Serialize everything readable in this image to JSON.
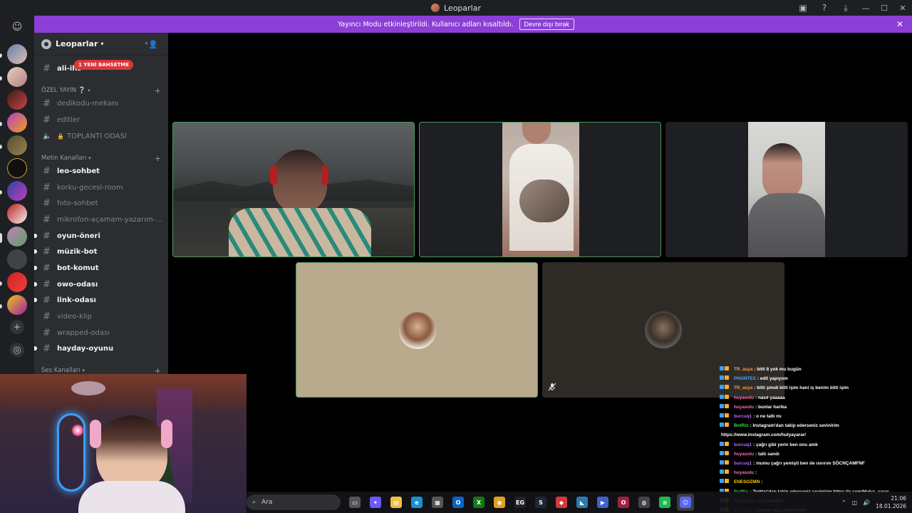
{
  "window": {
    "title": "Leoparlar"
  },
  "banner": {
    "text": "Yayıncı Modu etkinleştirildi. Kullanıcı adları kısaltıldı.",
    "button": "Devre dışı bırak"
  },
  "server": {
    "name": "Leoparlar"
  },
  "channels": {
    "top": {
      "name": "ali-ihs",
      "badge": "1 YENİ BAHSETME"
    },
    "cat_ozel": "ÖZEL YAYIN ❔",
    "ozel": [
      "dedikodu-mekanı",
      "editler",
      "TOPLANTI ODASI"
    ],
    "cat_metin": "Metin Kanalları",
    "metin": [
      "leo-sohbet",
      "korku-gecesi-room",
      "foto-sohbet",
      "mikrofon-açamam-yazarım-...",
      "oyun-öneri",
      "müzik-bot",
      "bot-komut",
      "owo-odası",
      "link-odası",
      "video-klip",
      "wrapped-odası",
      "hayday-oyunu"
    ],
    "cat_ses": "Ses Kanalları"
  },
  "chat": [
    {
      "user": "TR_asya",
      "color": "#ff9a3c",
      "text": ": bitti 8 yok mu bugün"
    },
    {
      "user": "PHONTEX",
      "color": "#4aa3ff",
      "text": ": edit yapıyom"
    },
    {
      "user": "TR_asya",
      "color": "#ff9a3c",
      "text": ": bitti şimdi bitti işim hani iş benim bitti işim"
    },
    {
      "user": "huyasolu",
      "color": "#ff6fb0",
      "text": ": nasıl yaaaaa"
    },
    {
      "user": "huyasolu",
      "color": "#ff6fb0",
      "text": ": bunlar harika"
    },
    {
      "user": "burcuq1",
      "color": "#b36bff",
      "text": ": o ne tatlı mı"
    },
    {
      "user": "BotRix",
      "color": "#39d353",
      "text": ": Instagram'dan takip ederseniz sevinirim"
    },
    {
      "user": "",
      "color": "#ffffff",
      "text": "https://www.instagram.com/hulyayarar/"
    },
    {
      "user": "burcuq1",
      "color": "#b36bff",
      "text": ": çağrı gibi yerin ben onu amk"
    },
    {
      "user": "huyasolu",
      "color": "#ff6fb0",
      "text": ": tatlı sandı"
    },
    {
      "user": "burcuq1",
      "color": "#b36bff",
      "text": ": mumu çağrı yemişti ben de ısırırım SÖCNÇAMFNF"
    },
    {
      "user": "huyasolu",
      "color": "#ff6fb0",
      "text": ":"
    },
    {
      "user": "ENESOZMN",
      "color": "#ffcc00",
      "text": ":"
    },
    {
      "user": "BotRix",
      "color": "#39d353",
      "text": ": Twitter'dan takip ederseniz sevinirim https://x.com/Hulya_yarar"
    },
    {
      "user": "huyasolu",
      "color": "#ff6fb0",
      "text": ": cins kedimi"
    },
    {
      "user": "burcuq1",
      "color": "#b36bff",
      "text": ": katman olsa bilirdi emir"
    }
  ],
  "taskbar": {
    "search_placeholder": "Ara",
    "apps": [
      "task-view",
      "copilot",
      "file-explorer",
      "edge",
      "microsoft-store",
      "outlook",
      "xbox",
      "chrome",
      "epic-games",
      "steam",
      "anydesk",
      "app-blue",
      "media-player",
      "opera-gx",
      "app-gray",
      "spotify",
      "discord"
    ],
    "time": "21:06",
    "date": "18.01.2026"
  }
}
